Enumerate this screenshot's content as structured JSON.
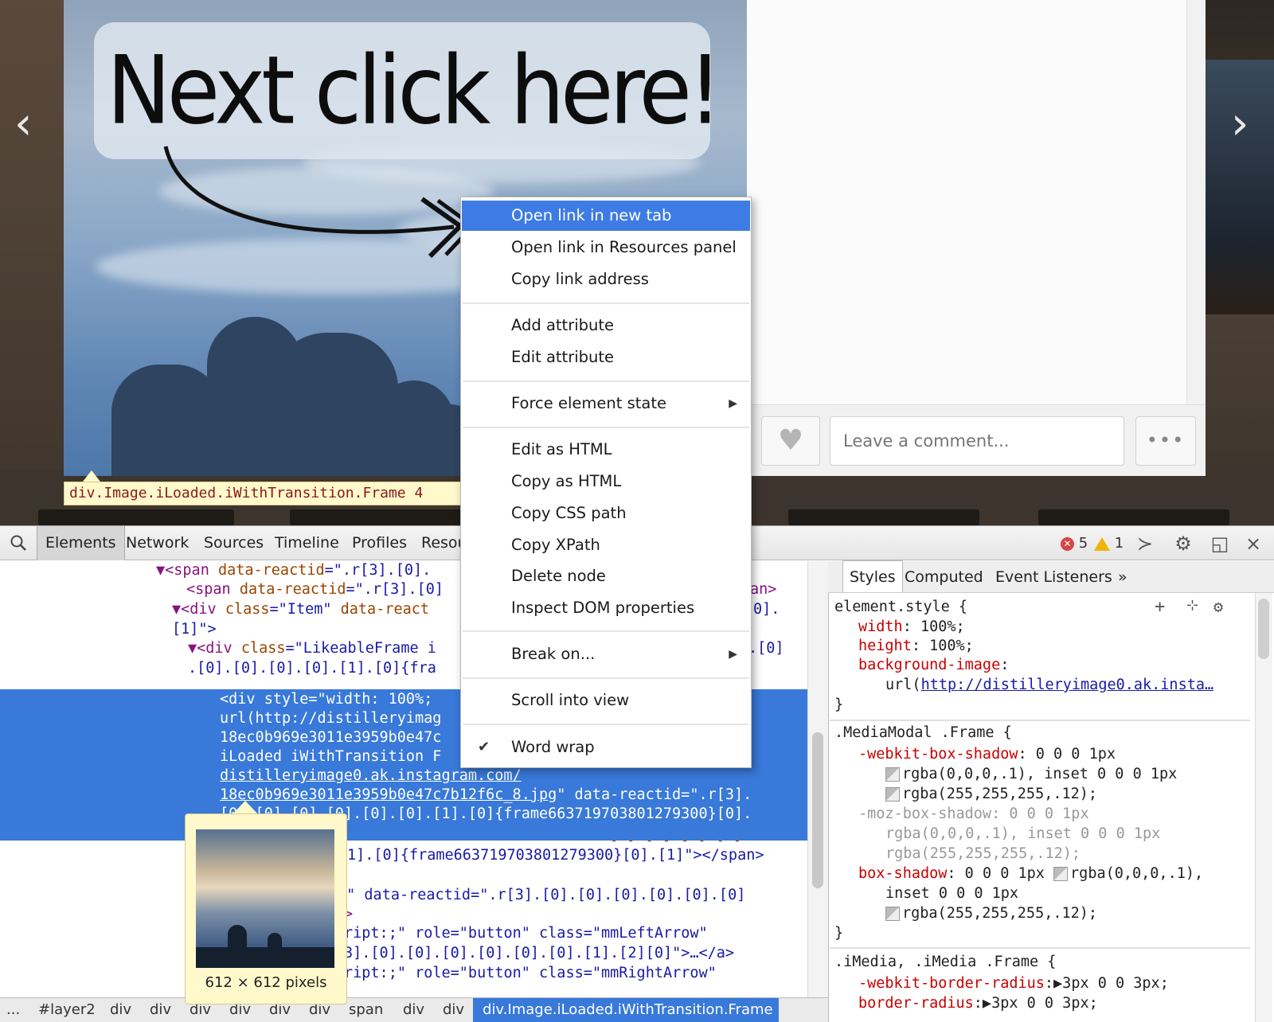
{
  "page": {
    "callout": "Next click here!",
    "comment_placeholder": "Leave a comment...",
    "more_label": "•••",
    "heart_icon": "heart-icon",
    "nav_prev": "‹",
    "nav_next": "›"
  },
  "element_tooltip": "div.Image.iLoaded.iWithTransition.Frame 4",
  "context_menu": {
    "items": [
      {
        "label": "Open link in new tab",
        "highlighted": true
      },
      {
        "label": "Open link in Resources panel"
      },
      {
        "label": "Copy link address"
      },
      {
        "label": "Add attribute"
      },
      {
        "label": "Edit attribute"
      },
      {
        "label": "Force element state",
        "submenu": true
      },
      {
        "label": "Edit as HTML"
      },
      {
        "label": "Copy as HTML"
      },
      {
        "label": "Copy CSS path"
      },
      {
        "label": "Copy XPath"
      },
      {
        "label": "Delete node"
      },
      {
        "label": "Inspect DOM properties"
      },
      {
        "label": "Break on...",
        "submenu": true
      },
      {
        "label": "Scroll into view"
      },
      {
        "label": "Word wrap",
        "checked": true
      }
    ],
    "submenu_glyph": "▶",
    "check_glyph": "✔"
  },
  "devtools": {
    "tabs": [
      "Elements",
      "Network",
      "Sources",
      "Timeline",
      "Profiles",
      "Resou"
    ],
    "errors": "5",
    "warnings": "1",
    "code": {
      "l1_tag": "▼<span ",
      "l1_attr": "data-reactid",
      "l1_val": "=\".r[3].[0].",
      "l2_tag": "<span ",
      "l2_attr": "data-reactid",
      "l2_val": "=\".r[3].[0]",
      "l2_end": "an>",
      "l3_tag": "▼<div ",
      "l3_attr": "class",
      "l3_val": "=\"Item\" ",
      "l3_attr2": "data-react",
      "l3_end": "0].",
      "l4": "[1]\">",
      "l5_tag": "▼<div ",
      "l5_attr": "class",
      "l5_val": "=\"LikeableFrame i",
      "l5_end": ".[0]",
      "l6": ".[0].[0].[0].[0].[1].[0]{fra",
      "sel1": "<div style=\"width: 100%;",
      "sel2": "url(http://distilleryimag",
      "sel3": "18ec0b969e3011e3959b0e47c",
      "sel4": "iLoaded iWithTransition F",
      "sel5": "distilleryimage0.ak.instagram.com/",
      "sel6a": "18ec0b969e3011e3959b0e47c7b12f6c_8.jpg",
      "sel6b": "\" data-reactid=\".r[3].",
      "sel7": "[0].[0].[0].[0].[0].[0].[1].[0]{frame663719703801279300}[0].",
      "a1_attr": "lbAnimation\" ",
      "a1_rest": "data-reactid=\".r[3].[0].[0].[0].",
      "a2": "1].[0]{frame663719703801279300}[0].[1]\"></span>",
      "a3": "o\" data-reactid=\".r[3].[0].[0].[0].[0].[0].[0]",
      "a4": ">",
      "a5": "ript:;\" role=\"button\" class=\"mmLeftArrow\"",
      "a6": "3].[0].[0].[0].[0].[0].[0].[1].[2][0]\">…</a>",
      "a7": "ript:;\" role=\"button\" class=\"mmRightArrow\""
    },
    "breadcrumbs": [
      "...",
      "#layer2",
      "div",
      "div",
      "div",
      "div",
      "div",
      "div",
      "span",
      "div",
      "div"
    ],
    "active_crumb": "div.Image.iLoaded.iWithTransition.Frame",
    "preview": {
      "caption": "612 × 612 pixels"
    }
  },
  "styles": {
    "tabs": [
      "Styles",
      "Computed",
      "Event Listeners"
    ],
    "more": "»",
    "element_selector": "element.style {",
    "p_width": "width",
    "v_width": ": 100%;",
    "p_height": "height",
    "v_height": ": 100%;",
    "p_bg": "background-image",
    "v_bg_pre": "url(",
    "v_bg_link": "http://distilleryimage0.ak.insta…",
    "close": "}",
    "r2_selector": ".MediaModal .Frame {",
    "r2_p1": "-webkit-box-shadow",
    "r2_v1": ": 0 0 0 1px",
    "r2_v1b": "rgba(0,0,0,.1), inset 0 0 0 1px",
    "r2_v1c": "rgba(255,255,255,.12);",
    "r2_p2": "-moz-box-shadow: 0 0 0 1px",
    "r2_v2b": "rgba(0,0,0,.1), inset 0 0 0 1px",
    "r2_v2c": "rgba(255,255,255,.12);",
    "r2_p3": "box-shadow",
    "r2_v3": ": 0 0 0 1px ",
    "r2_v3a": "rgba(0,0,0,.1),",
    "r2_v3b": "inset 0 0 0 1px",
    "r2_v3c": "rgba(255,255,255,.12);",
    "r3_selector": ".iMedia, .iMedia .Frame {",
    "r3_p1": "-webkit-border-radius",
    "r3_v1": ":▶3px 0 0 3px;",
    "r3_p2": "border-radius",
    "r3_v2": ":▶3px 0 0 3px;"
  },
  "colors": {
    "highlight": "#3e7be5",
    "selection": "#3879d9",
    "tooltip_bg": "#fff9cc"
  }
}
